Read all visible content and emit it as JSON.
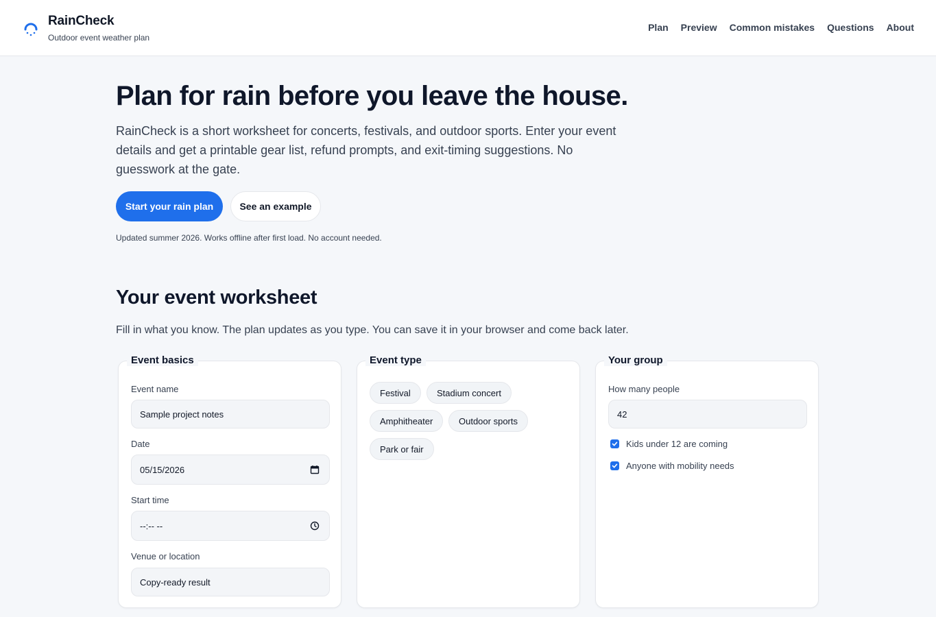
{
  "header": {
    "brand": "RainCheck",
    "tagline": "Outdoor event weather plan",
    "nav": [
      "Plan",
      "Preview",
      "Common mistakes",
      "Questions",
      "About"
    ]
  },
  "hero": {
    "title": "Plan for rain before you leave the house.",
    "lead": "RainCheck is a short worksheet for concerts, festivals, and outdoor sports. Enter your event details and get a printable gear list, refund prompts, and exit-timing suggestions. No guesswork at the gate.",
    "primary_button": "Start your rain plan",
    "secondary_button": "See an example",
    "note": "Updated summer 2026. Works offline after first load. No account needed."
  },
  "worksheet": {
    "title": "Your event worksheet",
    "subtitle": "Fill in what you know. The plan updates as you type. You can save it in your browser and come back later.",
    "basics": {
      "legend": "Event basics",
      "name_label": "Event name",
      "name_value": "Sample project notes",
      "date_label": "Date",
      "date_value": "05/15/2026",
      "time_label": "Start time",
      "time_value": "--:-- --",
      "venue_label": "Venue or location",
      "venue_value": "Copy-ready result"
    },
    "event_type": {
      "legend": "Event type",
      "options": [
        "Festival",
        "Stadium concert",
        "Amphitheater",
        "Outdoor sports",
        "Park or fair"
      ]
    },
    "group": {
      "legend": "Your group",
      "people_label": "How many people",
      "people_value": "42",
      "kids_label": "Kids under 12 are coming",
      "kids_checked": true,
      "mobility_label": "Anyone with mobility needs",
      "mobility_checked": true
    }
  },
  "colors": {
    "accent": "#1f6feb",
    "background": "#f5f7fa",
    "text": "#0f172a"
  },
  "icons": {
    "logo": "umbrella-rain-icon",
    "date": "calendar-icon",
    "time": "clock-icon",
    "check": "check-icon"
  }
}
